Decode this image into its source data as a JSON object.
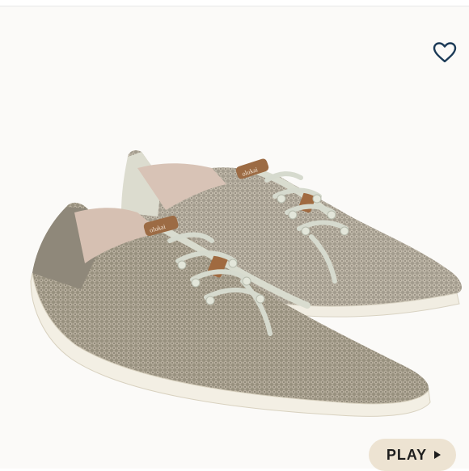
{
  "product": {
    "image_alt": "Pair of grey knit lace-up sneakers",
    "brand_tab_text": "olukai"
  },
  "actions": {
    "like_icon": "heart-outline-icon",
    "play_label": "PLAY",
    "play_icon": "play-triangle-icon"
  },
  "colors": {
    "heart_stroke": "#1b3a57",
    "play_bg": "#ede3d2"
  }
}
